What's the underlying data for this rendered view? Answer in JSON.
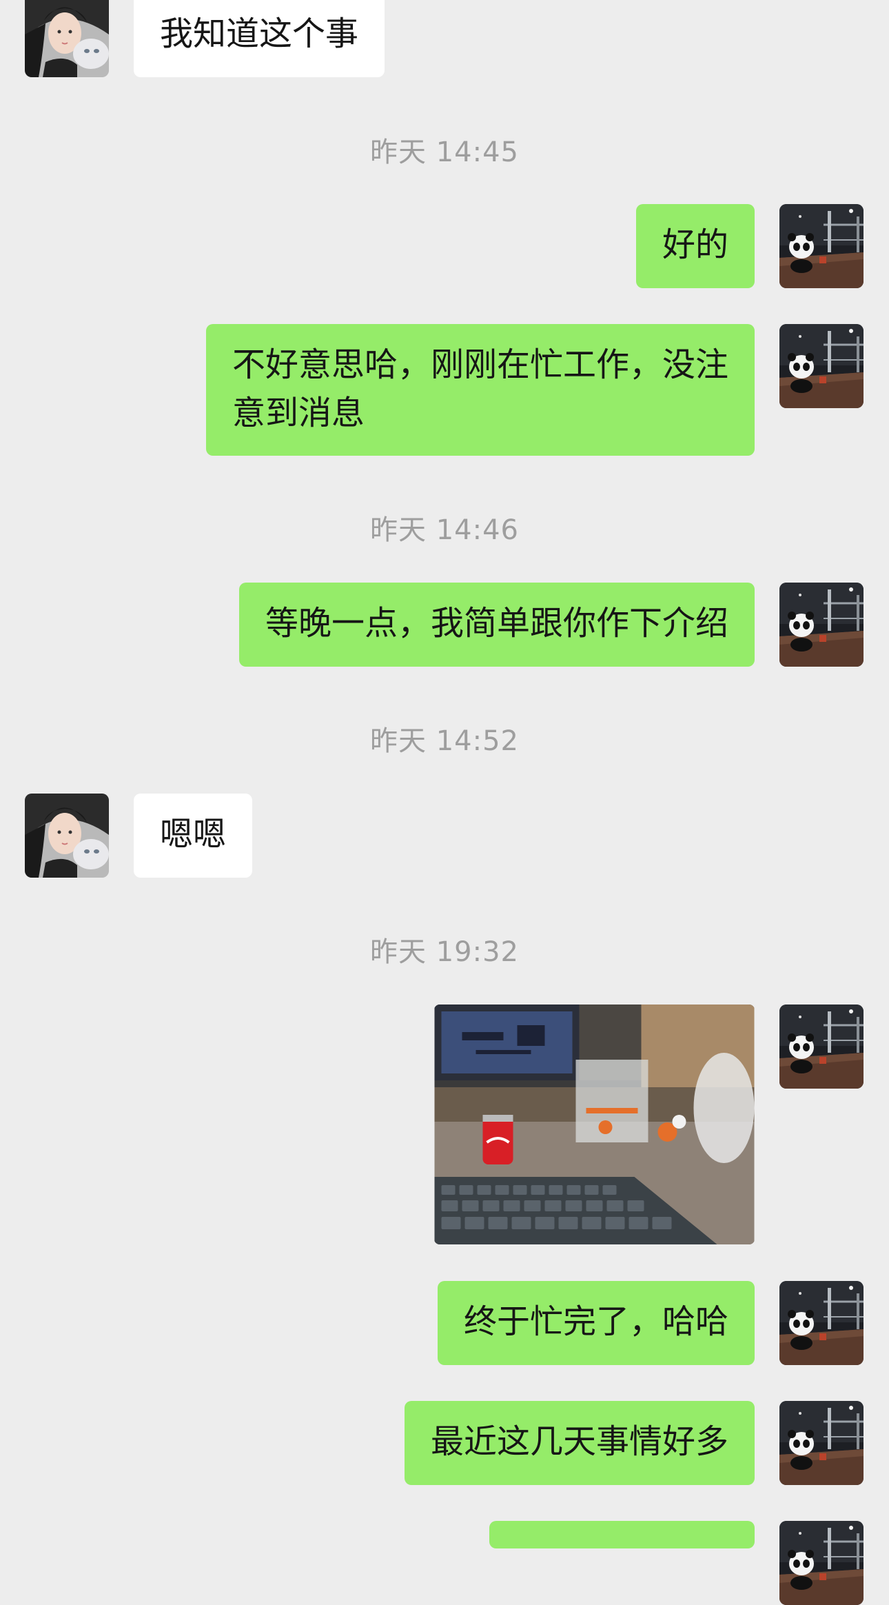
{
  "messages": [
    {
      "type": "in",
      "text": "我知道这个事"
    },
    {
      "type": "time",
      "text": "昨天 14:45"
    },
    {
      "type": "out",
      "text": "好的"
    },
    {
      "type": "out",
      "line1": "不好意思哈，刚刚在忙工作，没注",
      "line2": "意到消息"
    },
    {
      "type": "time",
      "text": "昨天 14:46"
    },
    {
      "type": "out",
      "text": "等晚一点，我简单跟你作下介绍"
    },
    {
      "type": "time",
      "text": "昨天 14:52"
    },
    {
      "type": "in",
      "text": "嗯嗯"
    },
    {
      "type": "time",
      "text": "昨天 19:32"
    },
    {
      "type": "out-image",
      "icon": "desk-photo"
    },
    {
      "type": "out",
      "text": "终于忙完了，哈哈"
    },
    {
      "type": "out",
      "text": "最近这几天事情好多"
    }
  ],
  "colors": {
    "background": "#ededed",
    "outgoing_bubble": "#95ec69",
    "incoming_bubble": "#ffffff",
    "timestamp": "#9e9e9e"
  },
  "avatars": {
    "contact": "contact-avatar",
    "self": "panda-avatar"
  }
}
